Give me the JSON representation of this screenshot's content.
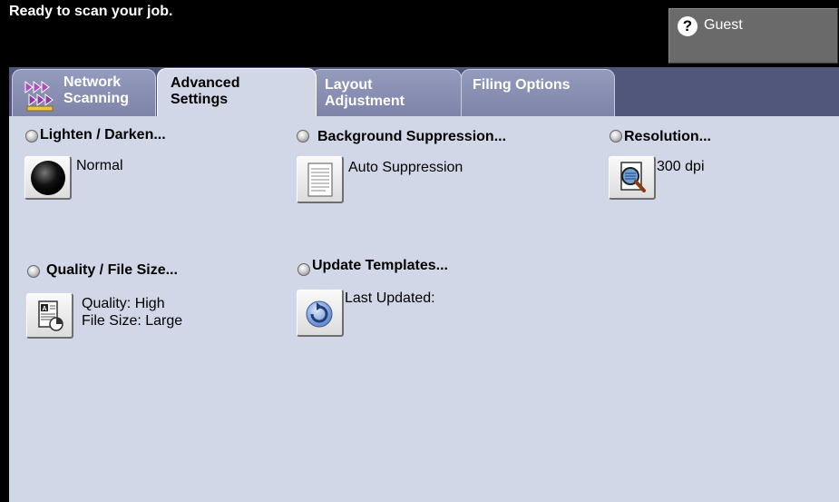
{
  "header": {
    "status": "Ready to scan your job.",
    "user_label": "Guest"
  },
  "tabs": [
    {
      "label": "Network\nScanning"
    },
    {
      "label": "Advanced\nSettings"
    },
    {
      "label": "Layout\nAdjustment"
    },
    {
      "label": "Filing Options"
    }
  ],
  "features": {
    "lighten": {
      "title": "Lighten / Darken...",
      "value": "Normal"
    },
    "background": {
      "title": "Background Suppression...",
      "value": "Auto Suppression"
    },
    "resolution": {
      "title": "Resolution...",
      "value": "300 dpi"
    },
    "quality": {
      "title": "Quality / File Size...",
      "value": "Quality: High\nFile Size: Large"
    },
    "templates": {
      "title": "Update Templates...",
      "value": "Last Updated:"
    }
  }
}
